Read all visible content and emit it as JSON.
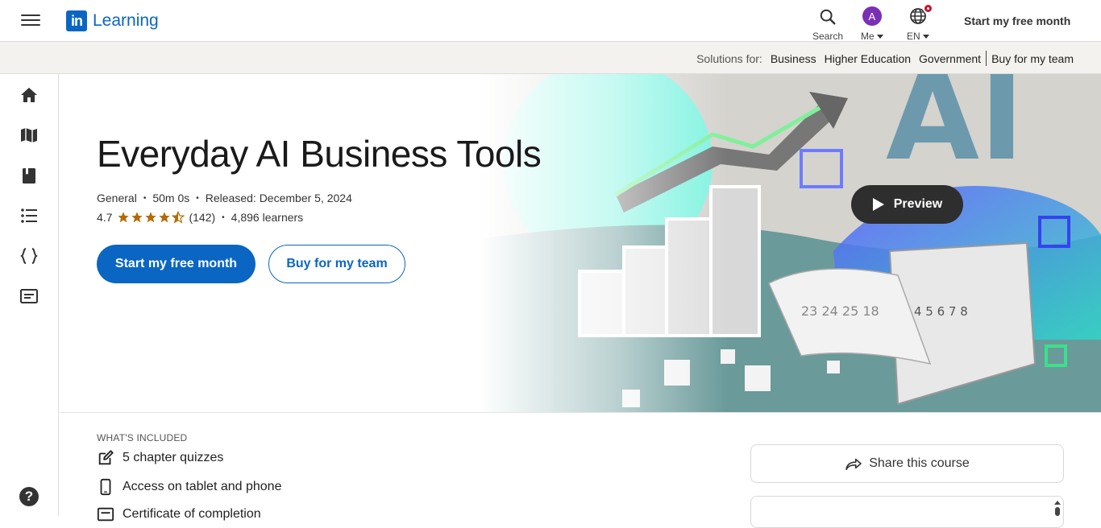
{
  "header": {
    "logo_text": "Learning",
    "logo_mark": "in",
    "nav": {
      "search_label": "Search",
      "me_label": "Me",
      "me_avatar": "A",
      "lang_label": "EN"
    },
    "cta": "Start my free month"
  },
  "solutions": {
    "prefix": "Solutions for:",
    "links": [
      "Business",
      "Higher Education",
      "Government",
      "Buy for my team"
    ]
  },
  "sidebar": {
    "icons": [
      "home-icon",
      "map-icon",
      "library-icon",
      "list-icon",
      "code-icon",
      "certificate-icon"
    ],
    "help": "?"
  },
  "course": {
    "title": "Everyday AI Business Tools",
    "category": "General",
    "duration": "50m 0s",
    "released": "Released: December 5, 2024",
    "rating": "4.7",
    "rating_value": 4.7,
    "reviews": "(142)",
    "learners": "4,896 learners",
    "primary_cta": "Start my free month",
    "secondary_cta": "Buy for my team",
    "preview": "Preview"
  },
  "included": {
    "title": "WHAT'S INCLUDED",
    "items": [
      {
        "icon": "edit-icon",
        "label": "5 chapter quizzes"
      },
      {
        "icon": "tablet-icon",
        "label": "Access on tablet and phone"
      },
      {
        "icon": "certificate-icon",
        "label": "Certificate of completion"
      }
    ]
  },
  "aside": {
    "share": "Share this course"
  },
  "colors": {
    "brand": "#0a66c2",
    "star": "#b36b00",
    "avatar": "#7b2fb5",
    "badge": "#cb112d"
  }
}
